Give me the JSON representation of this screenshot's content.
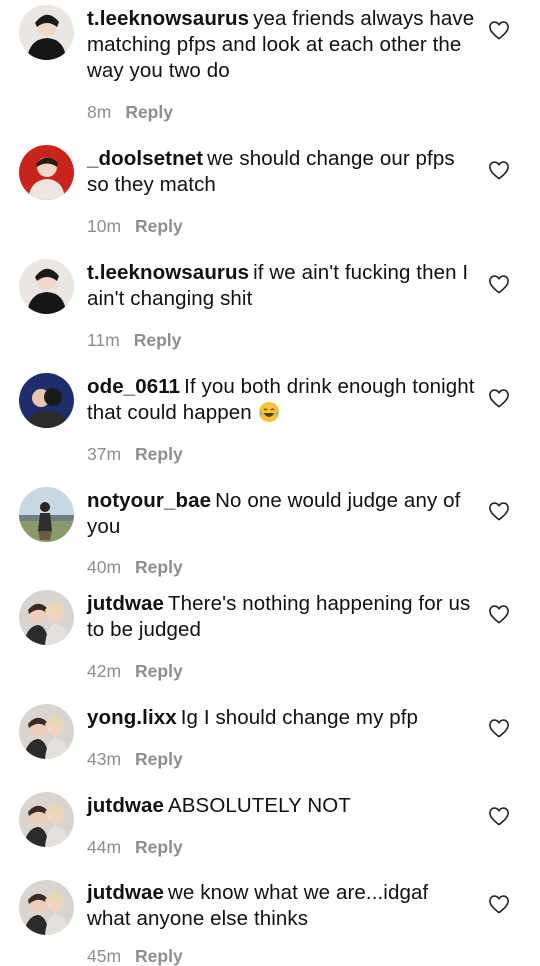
{
  "comments": [
    {
      "username": "t.leeknowsaurus",
      "text": "yea friends always have matching pfps and look at each other the way you two do",
      "time": "8m",
      "reply_label": "Reply",
      "avatar": "avatar-man-dark",
      "like_icon": "heart-outline-icon"
    },
    {
      "username": "_doolsetnet",
      "text": "we should change our pfps so they match",
      "time": "10m",
      "reply_label": "Reply",
      "avatar": "avatar-red-bg",
      "like_icon": "heart-outline-icon"
    },
    {
      "username": "t.leeknowsaurus",
      "text": "if we ain't fucking then I ain't changing shit",
      "time": "11m",
      "reply_label": "Reply",
      "avatar": "avatar-man-dark",
      "like_icon": "heart-outline-icon"
    },
    {
      "username": "ode_0611",
      "text": "If you both drink enough tonight that could happen",
      "emoji": "laughing-tears-emoji",
      "time": "37m",
      "reply_label": "Reply",
      "avatar": "avatar-couple-blue",
      "like_icon": "heart-outline-icon"
    },
    {
      "username": "notyour_bae",
      "text": "No one would judge any of you",
      "time": "40m",
      "reply_label": "Reply",
      "avatar": "avatar-landscape",
      "like_icon": "heart-outline-icon"
    },
    {
      "username": "jutdwae",
      "text": "There's nothing happening for us to be judged",
      "time": "42m",
      "reply_label": "Reply",
      "avatar": "avatar-two-people",
      "like_icon": "heart-outline-icon"
    },
    {
      "username": "yong.lixx",
      "text": "Ig I should change my pfp",
      "time": "43m",
      "reply_label": "Reply",
      "avatar": "avatar-two-people",
      "like_icon": "heart-outline-icon"
    },
    {
      "username": "jutdwae",
      "text": "ABSOLUTELY NOT",
      "time": "44m",
      "reply_label": "Reply",
      "avatar": "avatar-two-people",
      "like_icon": "heart-outline-icon"
    },
    {
      "username": "jutdwae",
      "text": "we know what we are...idgaf what anyone else thinks",
      "time": "45m",
      "reply_label": "Reply",
      "avatar": "avatar-two-people",
      "like_icon": "heart-outline-icon"
    }
  ]
}
